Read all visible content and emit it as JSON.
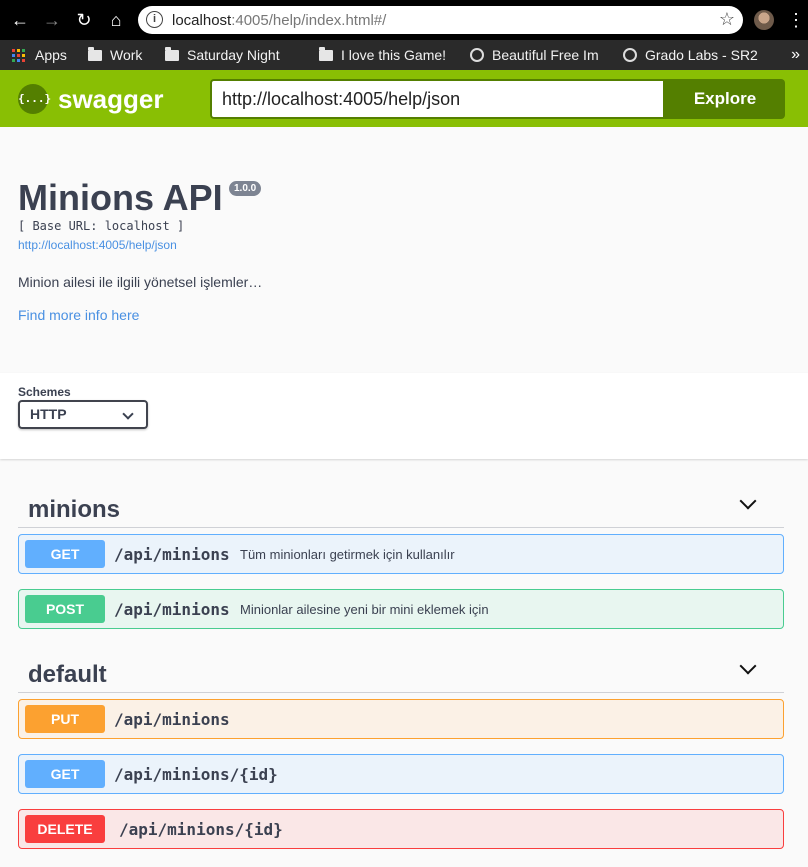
{
  "browser": {
    "url_host": "localhost",
    "url_rest": ":4005/help/index.html#/",
    "bookmarks": [
      "Apps",
      "Work",
      "Saturday Night",
      "I love this Game!",
      "Beautiful Free Im",
      "Grado Labs - SR2"
    ]
  },
  "topbar": {
    "brand": "swagger",
    "logo_glyph": "{...}",
    "spec_url": "http://localhost:4005/help/json",
    "explore_label": "Explore"
  },
  "info": {
    "title": "Minions API",
    "version": "1.0.0",
    "base_url": "[ Base URL: localhost ]",
    "spec_link": "http://localhost:4005/help/json",
    "description": "Minion ailesi ile ilgili yönetsel işlemler…",
    "more_info": "Find more info here"
  },
  "schemes": {
    "label": "Schemes",
    "selected": "HTTP"
  },
  "tags": [
    {
      "name": "minions",
      "operations": [
        {
          "method": "GET",
          "path": "/api/minions",
          "summary": "Tüm minionları getirmek için kullanılır"
        },
        {
          "method": "POST",
          "path": "/api/minions",
          "summary": "Minionlar ailesine yeni bir mini eklemek için"
        }
      ]
    },
    {
      "name": "default",
      "operations": [
        {
          "method": "PUT",
          "path": "/api/minions",
          "summary": ""
        },
        {
          "method": "GET",
          "path": "/api/minions/{id}",
          "summary": ""
        },
        {
          "method": "DELETE",
          "path": "/api/minions/{id}",
          "summary": ""
        }
      ]
    }
  ],
  "colors": {
    "topbar": "#89bf04",
    "topbar_dark": "#547f00",
    "get": "#61affe",
    "post": "#49cc90",
    "put": "#fca130",
    "delete": "#f93e3e",
    "link": "#4990e2",
    "text": "#3b4151"
  }
}
